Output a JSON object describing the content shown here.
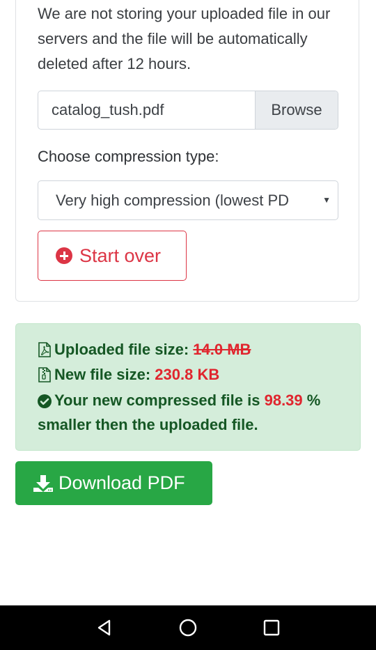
{
  "notice": {
    "text": "We are not storing your uploaded file in our servers and the file will be automatically deleted after 12 hours."
  },
  "upload": {
    "file_name": "catalog_tush.pdf",
    "browse_label": "Browse"
  },
  "compression": {
    "label": "Choose compression type:",
    "selected": "Very high compression (lowest PD"
  },
  "start_over": {
    "label": "Start over"
  },
  "result": {
    "uploaded_label": "Uploaded file size:",
    "uploaded_value": "14.0 MB",
    "new_label": "New file size:",
    "new_value": "230.8 KB",
    "reduction_prefix": "Your new compressed file is",
    "reduction_value": "98.39",
    "reduction_suffix": "%",
    "reduction_line2": "smaller then the uploaded file."
  },
  "download": {
    "label": "Download PDF"
  },
  "colors": {
    "success": "#28a745",
    "danger": "#dc3545",
    "alert_bg": "#d4edda",
    "alert_text": "#155724"
  }
}
